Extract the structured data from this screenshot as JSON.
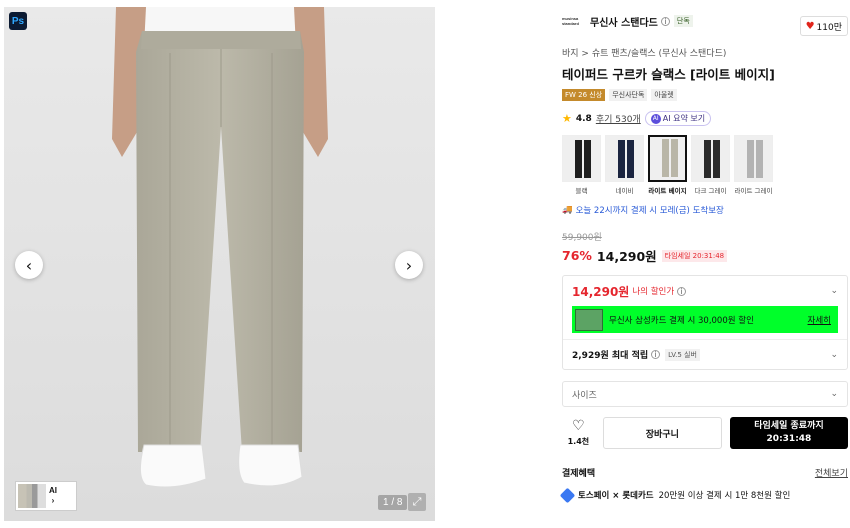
{
  "gallery": {
    "badge": "Ps",
    "thumb_ai_label": "AI",
    "counter": "1 / 8",
    "prev_glyph": "‹",
    "next_glyph": "›"
  },
  "brand": {
    "logo_text": "musinsa standard",
    "name": "무신사 스탠다드",
    "tag": "단독"
  },
  "likes": {
    "count": "110만",
    "color": "#e0241b"
  },
  "breadcrumb": "바지 > 슈트 팬츠/슬랙스 (무신사 스탠다드)",
  "product": {
    "title": "테이퍼드 구르카 슬랙스 [라이트 베이지]",
    "badges": [
      "FW 26 신상",
      "무신사단독",
      "아울렛"
    ]
  },
  "rating": {
    "score": "4.8",
    "review_text": "후기 530개",
    "ai_summary": "AI 요약 보기"
  },
  "colors": [
    {
      "label": "블랙",
      "pant_color": "#1e1e1e",
      "selected": false
    },
    {
      "label": "네이비",
      "pant_color": "#1b2540",
      "selected": false
    },
    {
      "label": "라이트 베이지",
      "pant_color": "#b9b6a7",
      "selected": true
    },
    {
      "label": "다크 그레이",
      "pant_color": "#2b2b2b",
      "selected": false
    },
    {
      "label": "라이트 그레이",
      "pant_color": "#b3b3b3",
      "selected": false
    }
  ],
  "delivery": "오늘 22시까지 결제 시 모레(금) 도착보장",
  "pricing": {
    "original": "59,900원",
    "discount": "76%",
    "price": "14,290원",
    "timesale": "타임세일 20:31:48"
  },
  "my_price": {
    "price": "14,290원",
    "label": "나의 할인가",
    "card_text": "무신사 삼성카드 결제 시 30,000원 할인",
    "card_detail": "자세히",
    "card_color": "#00ff2a",
    "points": "2,929원 최대 적립",
    "level": "LV.5 실버"
  },
  "size_select": {
    "placeholder": "사이즈"
  },
  "actions": {
    "wish_count": "1.4천",
    "cart": "장바구니",
    "buy_line1": "타임세일 종료까지",
    "buy_line2": "20:31:48"
  },
  "payment": {
    "title": "결제혜택",
    "view_all": "전체보기",
    "toss_brand": "토스페이 × 롯데카드",
    "toss_text": "20만원 이상 결제 시 1만 8천원 할인"
  },
  "colors_theme": {
    "accent_red": "#e5262e",
    "season_badge": "#c48a2c",
    "link_blue": "#2a5bd7"
  }
}
